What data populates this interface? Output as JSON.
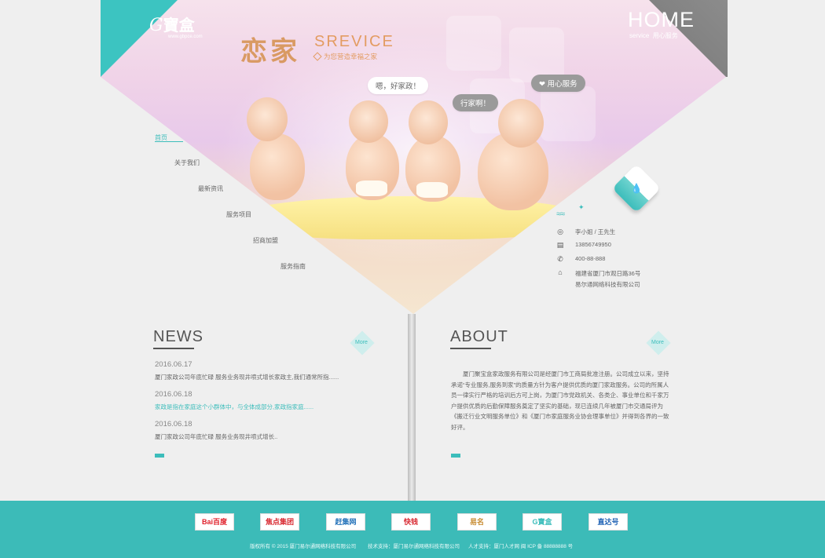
{
  "logo": {
    "mark": "G",
    "text": "寶盒",
    "url": "www.gbpce.com"
  },
  "corner": {
    "title": "HOME",
    "en": "service",
    "cn": "用心服务"
  },
  "hero": {
    "title_cn": "恋家",
    "title_en": "SREVICE",
    "subtitle": "为您营造幸福之家",
    "bubbles": [
      "嗯，好家政！",
      "行家啊！",
      "❤ 用心服务"
    ]
  },
  "nav": {
    "items": [
      "首页",
      "关于我们",
      "最新资讯",
      "服务项目",
      "招商加盟",
      "服务指南"
    ]
  },
  "contact": {
    "name": "李小姐 / 王先生",
    "phone": "13856749950",
    "hotline": "400-88-888",
    "address": "福建省厦门市观日路36号",
    "company": "易尔通网络科技有限公司"
  },
  "news": {
    "title": "NEWS",
    "more": "More",
    "items": [
      {
        "date": "2016.06.17",
        "text": "厦门家政公司年底忙碌 服务业务现井喷式增长家政主,我们通常所指......",
        "highlight": false
      },
      {
        "date": "2016.06.18",
        "text": "家政是指在家庭这个小群体中，与全体成部分,家政指家庭......",
        "highlight": true
      },
      {
        "date": "2016.06.18",
        "text": "厦门家政公司年底忙碌 服务业务现井喷式增长..",
        "highlight": false
      }
    ]
  },
  "about": {
    "title": "ABOUT",
    "more": "More",
    "text": "厦门聚宝盒家政服务有限公司是经厦门市工商局批准注册。公司成立以来，坚持承诺“专业服务,服务到家”的质量方针为客户提供优质的厦门家政服务。公司的所属人员一律实行严格的培训后方可上岗，为厦门市党政机关、各类企、事业单位和千家万户提供优质的后勤保障服务奠定了坚实的基础，现已连续几年被厦门市交通局评为《搬迁行业文明服务单位》和《厦门市家庭服务业协会理事单位》并得到各界的一致好评。"
  },
  "partners": [
    "Bai百度",
    "焦点集团",
    "赶集网",
    "快钱",
    "易名",
    "G寶盒",
    "直达号"
  ],
  "footer": {
    "copyright": "版权所有 © 2015 厦门易尔通网络科技有限公司",
    "tech": "技术支持：厦门易尔通网络科技有限公司",
    "talent": "人才支持：厦门人才网 闽 ICP 备 88888888 号"
  },
  "colors": {
    "accent": "#3cbdbb",
    "grey": "#7d7d7d",
    "title_orange": "#e39c62"
  }
}
